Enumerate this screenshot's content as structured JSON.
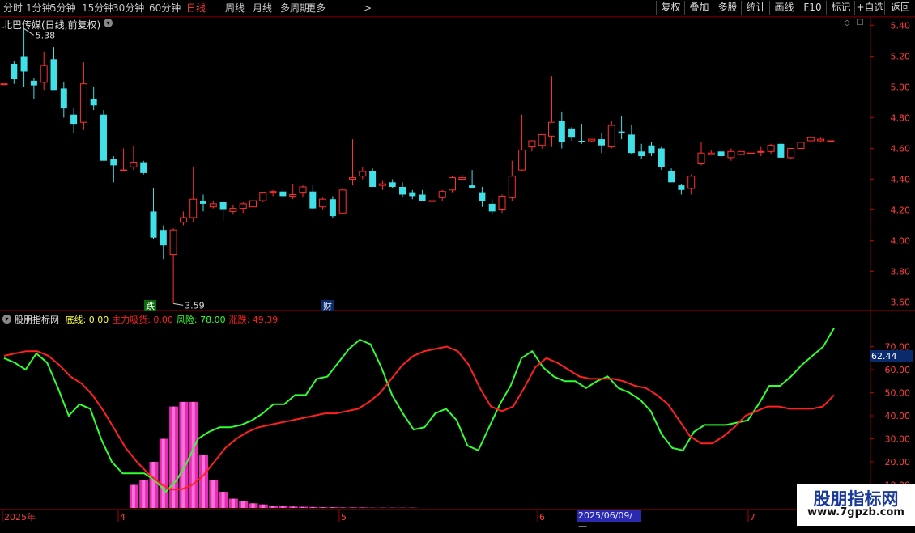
{
  "toolbar": {
    "timeframes": [
      "分时",
      "1分钟",
      "5分钟",
      "15分钟",
      "30分钟",
      "60分钟",
      "日线",
      "周线",
      "月线",
      "多周期",
      "更多"
    ],
    "active_timeframe": "日线",
    "right_buttons": [
      "复权",
      "叠加",
      "多股",
      "统计",
      "画线",
      "F10",
      "+自选",
      "返回"
    ],
    "extra_label": "标记"
  },
  "main_chart": {
    "title": "北巴传媒(日线,前复权)",
    "high_label": "5.38",
    "low_label": "3.59",
    "price_axis": [
      "5.40",
      "5.20",
      "5.00",
      "4.80",
      "4.60",
      "4.40",
      "4.20",
      "4.00",
      "3.80",
      "3.60"
    ],
    "marker_die": "跌",
    "marker_cai": "财",
    "colors": {
      "up": "#ff3030",
      "down": "#40e0e8"
    }
  },
  "indicator": {
    "name": "股朋指标网",
    "legend": [
      {
        "label": "底线:",
        "value": "0.00",
        "color": "#ffff40"
      },
      {
        "label": "主力吸货:",
        "value": "0.00",
        "color": "#ff2020"
      },
      {
        "label": "风险:",
        "value": "78.00",
        "color": "#30ff30"
      },
      {
        "label": "涨跌:",
        "value": "49.39",
        "color": "#ff2020"
      }
    ],
    "axis": [
      "70.00",
      "60.00",
      "50.00",
      "40.00",
      "30.00",
      "20.00",
      "10.00"
    ],
    "current_value": "62.44"
  },
  "time_axis": {
    "labels": [
      "2025年",
      "4",
      "5",
      "6",
      "7"
    ],
    "cursor_date": "2025/06/09/一"
  },
  "watermark": {
    "name": "股朋指标网",
    "url": "www.7gpzb.com"
  },
  "chart_data": {
    "type": "candlestick",
    "symbol": "北巴传媒",
    "period": "日线,前复权",
    "ylim": [
      3.55,
      5.45
    ],
    "candles": [
      [
        5.02,
        5.02,
        5.02,
        5.02
      ],
      [
        5.15,
        5.17,
        5.02,
        5.05
      ],
      [
        5.2,
        5.38,
        5.0,
        5.1
      ],
      [
        5.04,
        5.06,
        4.92,
        5.01
      ],
      [
        5.03,
        5.23,
        4.98,
        5.14
      ],
      [
        5.18,
        5.26,
        4.98,
        4.98
      ],
      [
        4.99,
        5.03,
        4.8,
        4.86
      ],
      [
        4.82,
        4.86,
        4.7,
        4.76
      ],
      [
        4.77,
        5.16,
        4.72,
        5.02
      ],
      [
        4.92,
        5.0,
        4.85,
        4.88
      ],
      [
        4.82,
        4.85,
        4.52,
        4.52
      ],
      [
        4.53,
        4.55,
        4.38,
        4.49
      ],
      [
        4.46,
        4.6,
        4.45,
        4.46
      ],
      [
        4.48,
        4.62,
        4.46,
        4.51
      ],
      [
        4.51,
        4.52,
        4.43,
        4.44
      ],
      [
        4.19,
        4.34,
        4.01,
        4.02
      ],
      [
        4.07,
        4.1,
        3.88,
        3.97
      ],
      [
        3.91,
        4.08,
        3.59,
        4.07
      ],
      [
        4.12,
        4.19,
        4.1,
        4.15
      ],
      [
        4.15,
        4.48,
        4.12,
        4.27
      ],
      [
        4.26,
        4.3,
        4.19,
        4.24
      ],
      [
        4.22,
        4.26,
        4.21,
        4.24
      ],
      [
        4.25,
        4.26,
        4.13,
        4.2
      ],
      [
        4.19,
        4.23,
        4.17,
        4.21
      ],
      [
        4.21,
        4.25,
        4.18,
        4.24
      ],
      [
        4.22,
        4.28,
        4.2,
        4.26
      ],
      [
        4.26,
        4.31,
        4.25,
        4.31
      ],
      [
        4.31,
        4.33,
        4.29,
        4.32
      ],
      [
        4.32,
        4.34,
        4.28,
        4.29
      ],
      [
        4.29,
        4.37,
        4.27,
        4.3
      ],
      [
        4.31,
        4.36,
        4.28,
        4.35
      ],
      [
        4.32,
        4.36,
        4.2,
        4.21
      ],
      [
        4.22,
        4.28,
        4.2,
        4.27
      ],
      [
        4.27,
        4.29,
        4.15,
        4.16
      ],
      [
        4.18,
        4.34,
        4.17,
        4.33
      ],
      [
        4.4,
        4.66,
        4.36,
        4.41
      ],
      [
        4.42,
        4.48,
        4.4,
        4.45
      ],
      [
        4.45,
        4.47,
        4.35,
        4.35
      ],
      [
        4.36,
        4.39,
        4.33,
        4.37
      ],
      [
        4.38,
        4.4,
        4.34,
        4.35
      ],
      [
        4.35,
        4.38,
        4.28,
        4.3
      ],
      [
        4.31,
        4.33,
        4.27,
        4.29
      ],
      [
        4.3,
        4.33,
        4.26,
        4.26
      ],
      [
        4.26,
        4.26,
        4.26,
        4.26
      ],
      [
        4.28,
        4.33,
        4.26,
        4.32
      ],
      [
        4.33,
        4.42,
        4.31,
        4.41
      ],
      [
        4.4,
        4.43,
        4.39,
        4.41
      ],
      [
        4.36,
        4.46,
        4.34,
        4.34
      ],
      [
        4.31,
        4.35,
        4.22,
        4.26
      ],
      [
        4.24,
        4.27,
        4.17,
        4.19
      ],
      [
        4.2,
        4.3,
        4.18,
        4.29
      ],
      [
        4.28,
        4.52,
        4.26,
        4.42
      ],
      [
        4.46,
        4.82,
        4.45,
        4.59
      ],
      [
        4.61,
        4.65,
        4.58,
        4.65
      ],
      [
        4.62,
        4.69,
        4.6,
        4.69
      ],
      [
        4.68,
        5.07,
        4.61,
        4.77
      ],
      [
        4.78,
        4.84,
        4.6,
        4.64
      ],
      [
        4.73,
        4.74,
        4.65,
        4.67
      ],
      [
        4.65,
        4.76,
        4.63,
        4.64
      ],
      [
        4.65,
        4.66,
        4.64,
        4.66
      ],
      [
        4.66,
        4.7,
        4.57,
        4.62
      ],
      [
        4.61,
        4.78,
        4.6,
        4.75
      ],
      [
        4.71,
        4.81,
        4.66,
        4.7
      ],
      [
        4.69,
        4.75,
        4.56,
        4.57
      ],
      [
        4.58,
        4.63,
        4.53,
        4.55
      ],
      [
        4.62,
        4.64,
        4.55,
        4.57
      ],
      [
        4.6,
        4.61,
        4.46,
        4.48
      ],
      [
        4.45,
        4.47,
        4.38,
        4.38
      ],
      [
        4.36,
        4.37,
        4.3,
        4.33
      ],
      [
        4.34,
        4.43,
        4.3,
        4.42
      ],
      [
        4.5,
        4.64,
        4.49,
        4.57
      ],
      [
        4.56,
        4.59,
        4.56,
        4.57
      ],
      [
        4.58,
        4.59,
        4.53,
        4.55
      ],
      [
        4.54,
        4.6,
        4.52,
        4.58
      ],
      [
        4.56,
        4.58,
        4.56,
        4.58
      ],
      [
        4.57,
        4.58,
        4.55,
        4.57
      ],
      [
        4.58,
        4.61,
        4.55,
        4.58
      ],
      [
        4.58,
        4.63,
        4.56,
        4.62
      ],
      [
        4.63,
        4.65,
        4.54,
        4.54
      ],
      [
        4.54,
        4.6,
        4.53,
        4.6
      ],
      [
        4.6,
        4.64,
        4.6,
        4.64
      ],
      [
        4.65,
        4.68,
        4.64,
        4.67
      ],
      [
        4.65,
        4.67,
        4.64,
        4.66
      ],
      [
        4.65,
        4.65,
        4.65,
        4.65
      ]
    ],
    "indicator_series": [
      {
        "name": "风险",
        "color": "#30ff30",
        "values": [
          65,
          63,
          60,
          67,
          63,
          52,
          40,
          45,
          43,
          30,
          20,
          15,
          15,
          15,
          12,
          7,
          12,
          20,
          30,
          33,
          35,
          35,
          36,
          38,
          41,
          45,
          45,
          49,
          49,
          56,
          57,
          63,
          69,
          73,
          71,
          61,
          49,
          41,
          34,
          35,
          41,
          43,
          38,
          27,
          25,
          35,
          45,
          53,
          65,
          68,
          61,
          57,
          55,
          55,
          52,
          55,
          57,
          52,
          50,
          47,
          42,
          32,
          26,
          25,
          33,
          36,
          36,
          36,
          37,
          38,
          45,
          53,
          53,
          57,
          62,
          66,
          70,
          78
        ]
      },
      {
        "name": "涨跌",
        "color": "#ff2020",
        "values": [
          66,
          67,
          68,
          68,
          66,
          62,
          57,
          54,
          49,
          42,
          34,
          26,
          20,
          15,
          11,
          8,
          8,
          10,
          14,
          20,
          26,
          30,
          33,
          35,
          36,
          37,
          38,
          39,
          40,
          41,
          41,
          42,
          43,
          46,
          50,
          56,
          62,
          66,
          68,
          69,
          70,
          68,
          62,
          52,
          44,
          42,
          44,
          52,
          61,
          65,
          63,
          60,
          57,
          56,
          56,
          56,
          55,
          53,
          52,
          49,
          45,
          38,
          31,
          28,
          28,
          31,
          35,
          40,
          42,
          44,
          44,
          43,
          43,
          43,
          44,
          49
        ]
      }
    ],
    "volume_bars": [
      0,
      0,
      0,
      0,
      0,
      0,
      0,
      0,
      0,
      0,
      0,
      0,
      0,
      10,
      12,
      20,
      30,
      44,
      46,
      46,
      23,
      12,
      7,
      4,
      3,
      2,
      1.5,
      1,
      0.8,
      0.6,
      0.5,
      0.4,
      0.3,
      0.3,
      0.2,
      0.2,
      0.2,
      0.1,
      0.1,
      0.1,
      0.1,
      0.1
    ],
    "ind_ylim": [
      0,
      80
    ]
  }
}
